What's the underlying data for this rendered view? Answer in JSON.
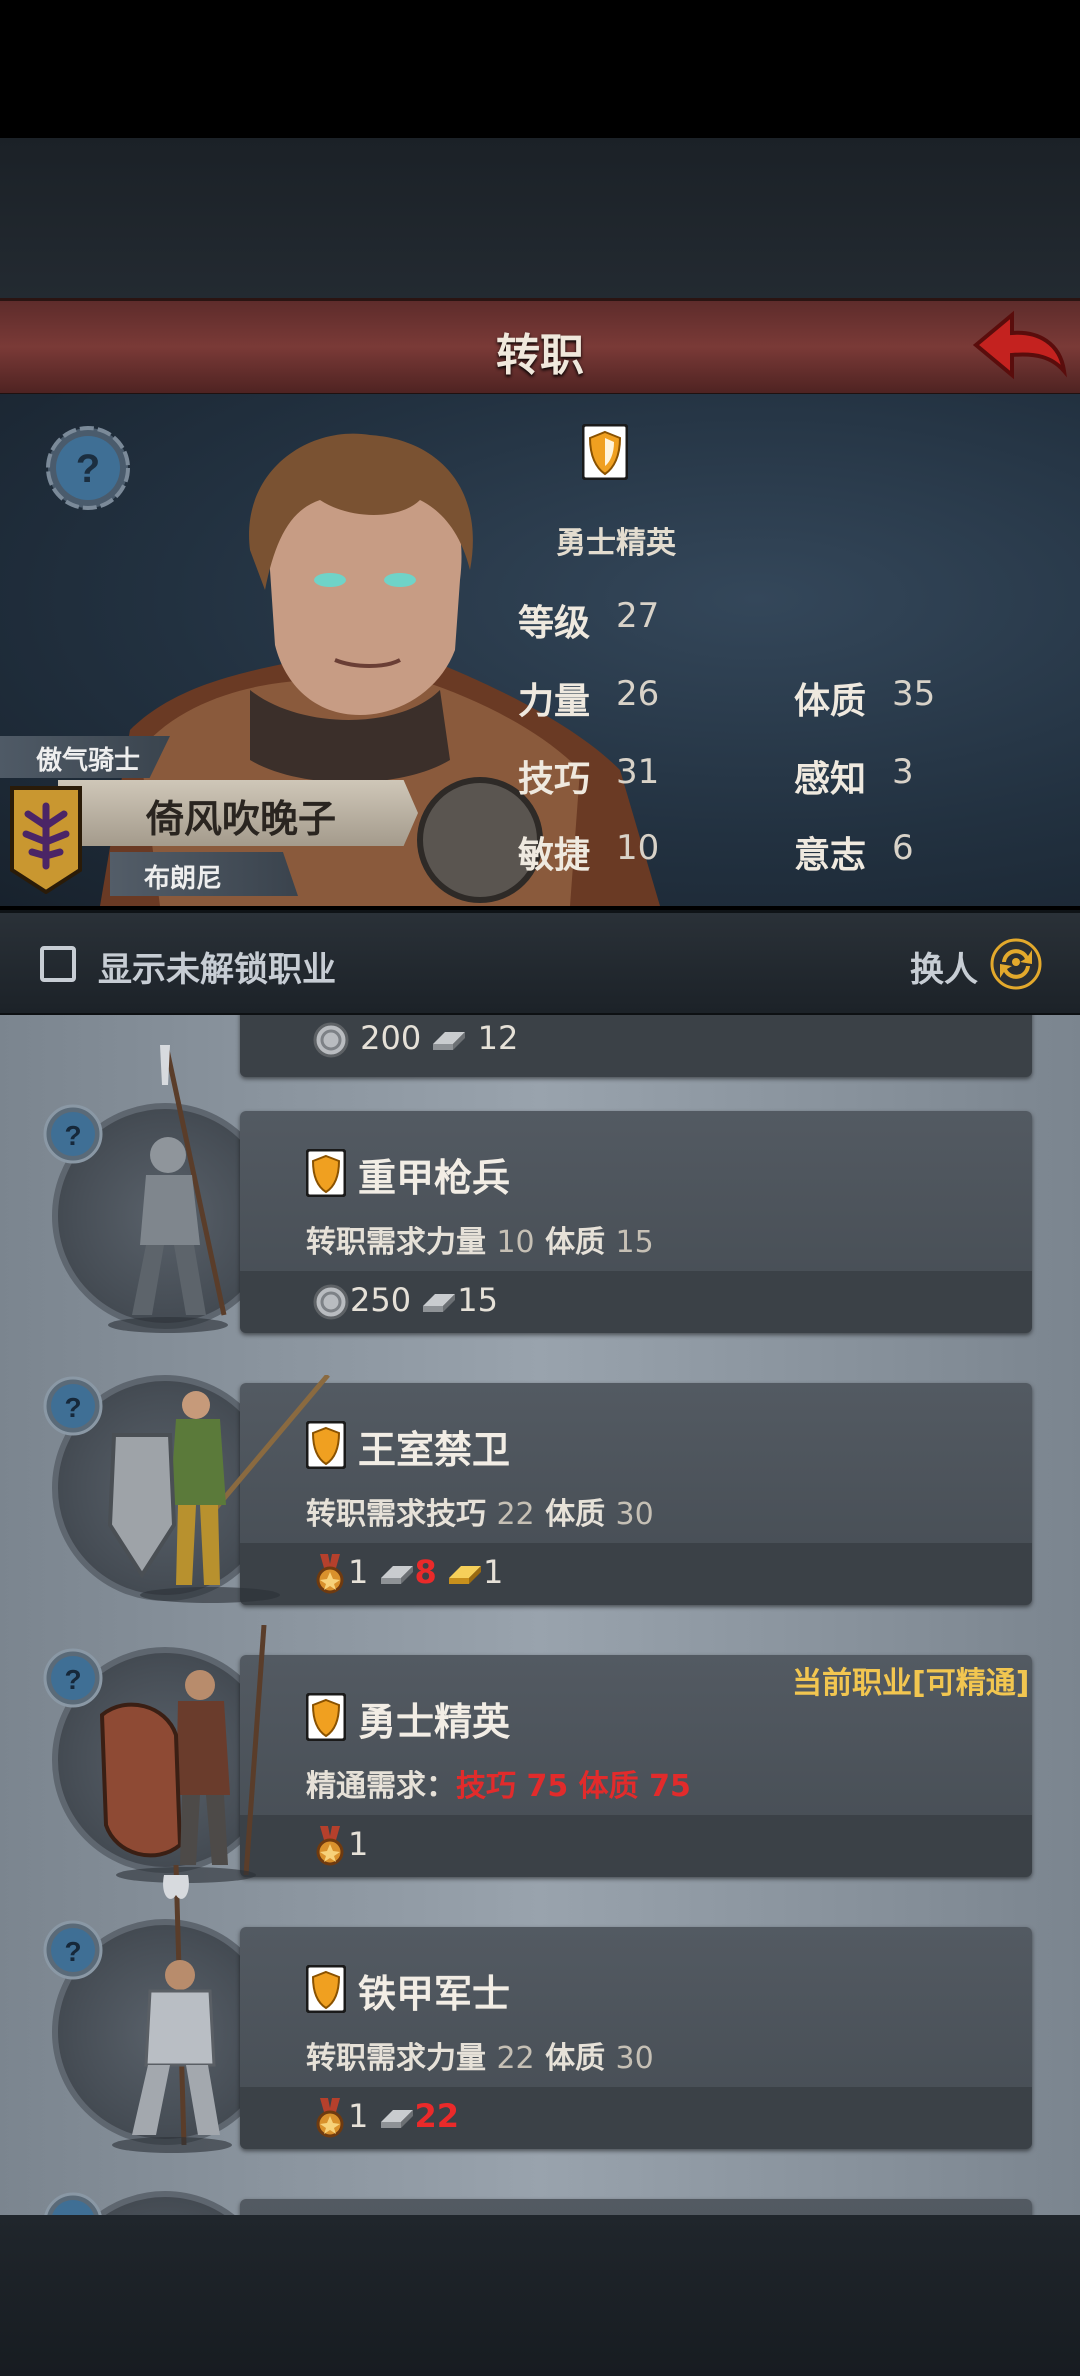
{
  "header": {
    "title": "转职"
  },
  "hero": {
    "class_name": "勇士精英",
    "title": "傲气骑士",
    "name": "倚风吹晚子",
    "subtitle": "布朗尼",
    "stats": {
      "level_label": "等级",
      "level": "27",
      "strength_label": "力量",
      "strength": "26",
      "constitution_label": "体质",
      "constitution": "35",
      "skill_label": "技巧",
      "skill": "31",
      "perception_label": "感知",
      "perception": "3",
      "agility_label": "敏捷",
      "agility": "10",
      "will_label": "意志",
      "will": "6"
    }
  },
  "filter": {
    "unlock_label": "显示未解锁职业",
    "swap_label": "换人"
  },
  "partial_top": {
    "silver": "200",
    "ingot": "12"
  },
  "classes": [
    {
      "name": "重甲枪兵",
      "req_prefix": "转职需求",
      "req1_label": "力量",
      "req1_value": "10",
      "req2_label": "体质",
      "req2_value": "15",
      "cost_silver": "250",
      "cost_ingot": "15"
    },
    {
      "name": "王室禁卫",
      "req_prefix": "转职需求",
      "req1_label": "技巧",
      "req1_value": "22",
      "req2_label": "体质",
      "req2_value": "30",
      "cost_medal": "1",
      "cost_ingot": "8",
      "cost_gold": "1"
    },
    {
      "name": "勇士精英",
      "current_tag": "当前职业[可精通]",
      "req_prefix": "精通需求：",
      "req1_label": "技巧",
      "req1_value": "75",
      "req2_label": "体质",
      "req2_value": "75",
      "cost_medal": "1"
    },
    {
      "name": "铁甲军士",
      "req_prefix": "转职需求",
      "req1_label": "力量",
      "req1_value": "22",
      "req2_label": "体质",
      "req2_value": "30",
      "cost_medal": "1",
      "cost_ingot": "22"
    }
  ],
  "colors": {
    "header": "#6e3331",
    "accent_gold": "#f2c650",
    "insufficient": "#e22b2b",
    "back_arrow": "#c4221f"
  }
}
